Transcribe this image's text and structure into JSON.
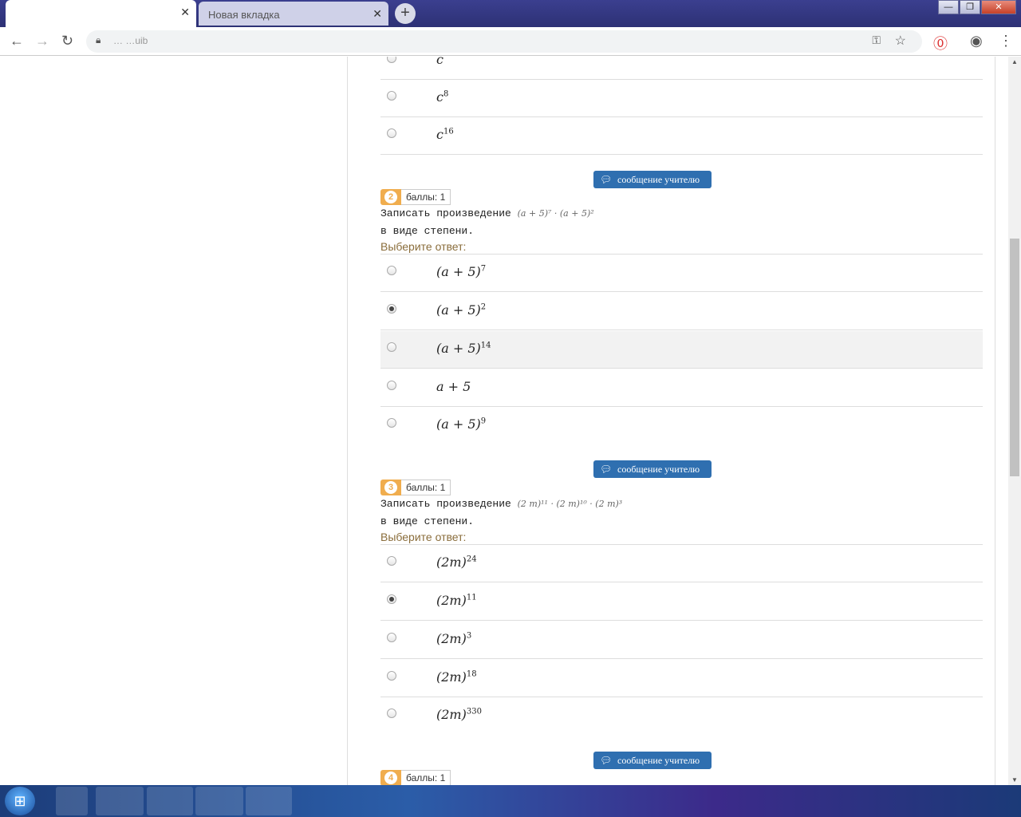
{
  "browser": {
    "tabs": [
      {
        "title": "",
        "close": "✕"
      },
      {
        "title": "Новая вкладка",
        "close": "✕"
      }
    ],
    "new_tab": "+",
    "window_buttons": {
      "minimize": "—",
      "maximize": "❐",
      "close": "✕"
    },
    "url": "… …uib"
  },
  "options_top": [
    {
      "base": "c",
      "exp": "",
      "checked": false
    },
    {
      "base": "c",
      "exp": "8",
      "checked": false
    },
    {
      "base": "c",
      "exp": "16",
      "checked": false
    }
  ],
  "teacher_button": "сообщение учителю",
  "score_label": "баллы: 1",
  "choose_label": "Выберите ответ:",
  "q2": {
    "num": "2",
    "text1": "Записать произведение",
    "formula": "(a + 5)⁷ · (a + 5)²",
    "text2": "в виде степени.",
    "options": [
      {
        "base": "(a + 5)",
        "exp": "7"
      },
      {
        "base": "(a + 5)",
        "exp": "2"
      },
      {
        "base": "(a + 5)",
        "exp": "14"
      },
      {
        "base": "a + 5",
        "exp": ""
      },
      {
        "base": "(a + 5)",
        "exp": "9"
      }
    ],
    "selected_index": 1
  },
  "q3": {
    "num": "3",
    "text1": "Записать произведение",
    "formula": "(2 m)¹¹ · (2 m)¹⁰ · (2 m)³",
    "text2": "в виде степени.",
    "options": [
      {
        "base": "(2m)",
        "exp": "24"
      },
      {
        "base": "(2m)",
        "exp": "11"
      },
      {
        "base": "(2m)",
        "exp": "3"
      },
      {
        "base": "(2m)",
        "exp": "18"
      },
      {
        "base": "(2m)",
        "exp": "330"
      }
    ],
    "selected_index": 1
  },
  "q4": {
    "num": "4"
  }
}
